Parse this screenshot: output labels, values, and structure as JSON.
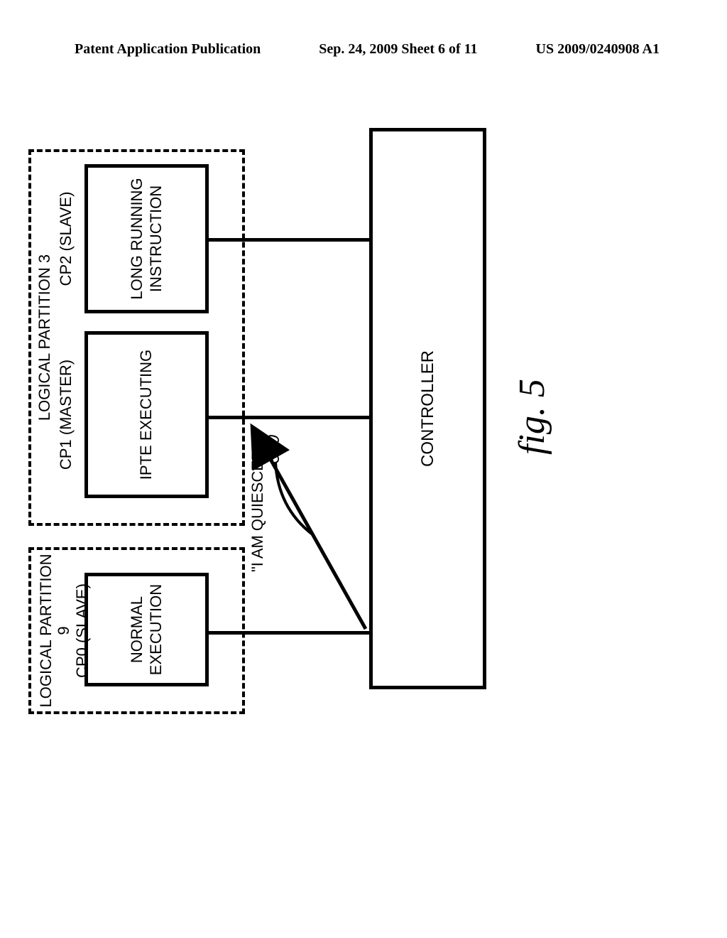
{
  "header": {
    "left": "Patent Application Publication",
    "center": "Sep. 24, 2009  Sheet 6 of 11",
    "right": "US 2009/0240908 A1"
  },
  "diagram": {
    "partition9": {
      "title": "LOGICAL PARTITION 9\nCP0 (SLAVE)",
      "box": "NORMAL\nEXECUTION"
    },
    "partition3": {
      "title": "LOGICAL PARTITION 3",
      "cp1": {
        "label": "CP1 (MASTER)",
        "box": "IPTE EXECUTING"
      },
      "cp2": {
        "label": "CP2 (SLAVE)",
        "box": "LONG RUNNING\nINSTRUCTION"
      }
    },
    "message": "\"I AM QUIESCED\"",
    "reference": "500",
    "controller": "CONTROLLER",
    "figure_label": "fig. 5"
  }
}
